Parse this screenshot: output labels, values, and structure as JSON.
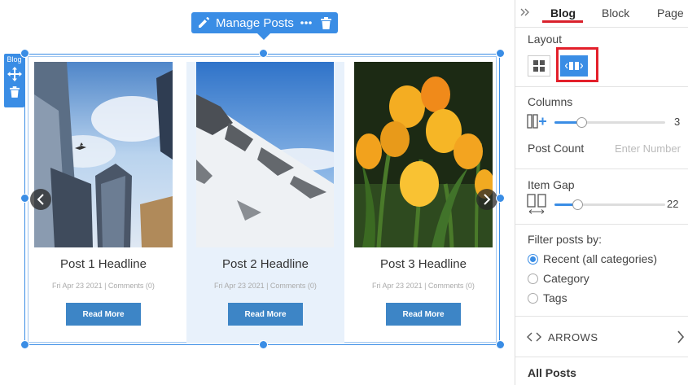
{
  "toolbar": {
    "label": "Manage Posts",
    "icons": [
      "pencil-icon",
      "more-dots-icon",
      "trash-icon"
    ]
  },
  "side_tools": {
    "label": "Blog",
    "icons": [
      "move-icon",
      "trash-icon"
    ]
  },
  "posts": [
    {
      "headline": "Post 1 Headline",
      "meta": "Fri Apr 23 2021  |  Comments (0)",
      "button": "Read More",
      "image": "city-skyscrapers"
    },
    {
      "headline": "Post 2 Headline",
      "meta": "Fri Apr 23 2021  |  Comments (0)",
      "button": "Read More",
      "image": "snowy-mountain"
    },
    {
      "headline": "Post 3 Headline",
      "meta": "Fri Apr 23 2021  |  Comments (0)",
      "button": "Read More",
      "image": "yellow-tulips"
    }
  ],
  "panel": {
    "tabs": [
      "Blog",
      "Block",
      "Page"
    ],
    "active_tab": "Blog",
    "layout_label": "Layout",
    "layout_options": [
      "grid-layout-icon",
      "slider-layout-icon"
    ],
    "selected_layout": "slider",
    "columns_label": "Columns",
    "columns_value": "3",
    "post_count_label": "Post Count",
    "post_count_placeholder": "Enter Number",
    "item_gap_label": "Item Gap",
    "item_gap_value": "22",
    "filter_label": "Filter posts by:",
    "filter_options": [
      "Recent (all categories)",
      "Category",
      "Tags"
    ],
    "filter_selected": "Recent (all categories)",
    "arrows_label": "ARROWS",
    "all_posts_label": "All Posts"
  },
  "colors": {
    "accent": "#3a8de5",
    "button": "#3d85c6",
    "tab_underline": "#d9212c",
    "highlight": "#e3202b"
  }
}
